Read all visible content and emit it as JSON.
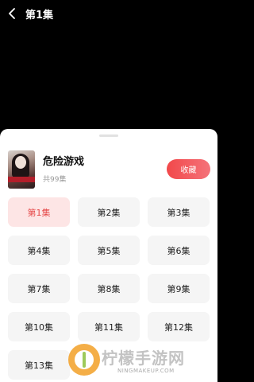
{
  "header": {
    "episode_title": "第1集"
  },
  "sheet": {
    "drama_title": "危险游戏",
    "episode_count": "共99集",
    "favorite_label": "收藏",
    "cover_text": "危险游戏"
  },
  "episodes": [
    "第1集",
    "第2集",
    "第3集",
    "第4集",
    "第5集",
    "第6集",
    "第7集",
    "第8集",
    "第9集",
    "第10集",
    "第11集",
    "第12集",
    "第13集"
  ],
  "active_episode_index": 0,
  "watermark": {
    "text": "柠檬手游网",
    "sub": "NINGMAKEUP.COM"
  },
  "colors": {
    "accent": "#f2484a",
    "active_bg": "#fde5e5",
    "active_text": "#e64b4b"
  }
}
